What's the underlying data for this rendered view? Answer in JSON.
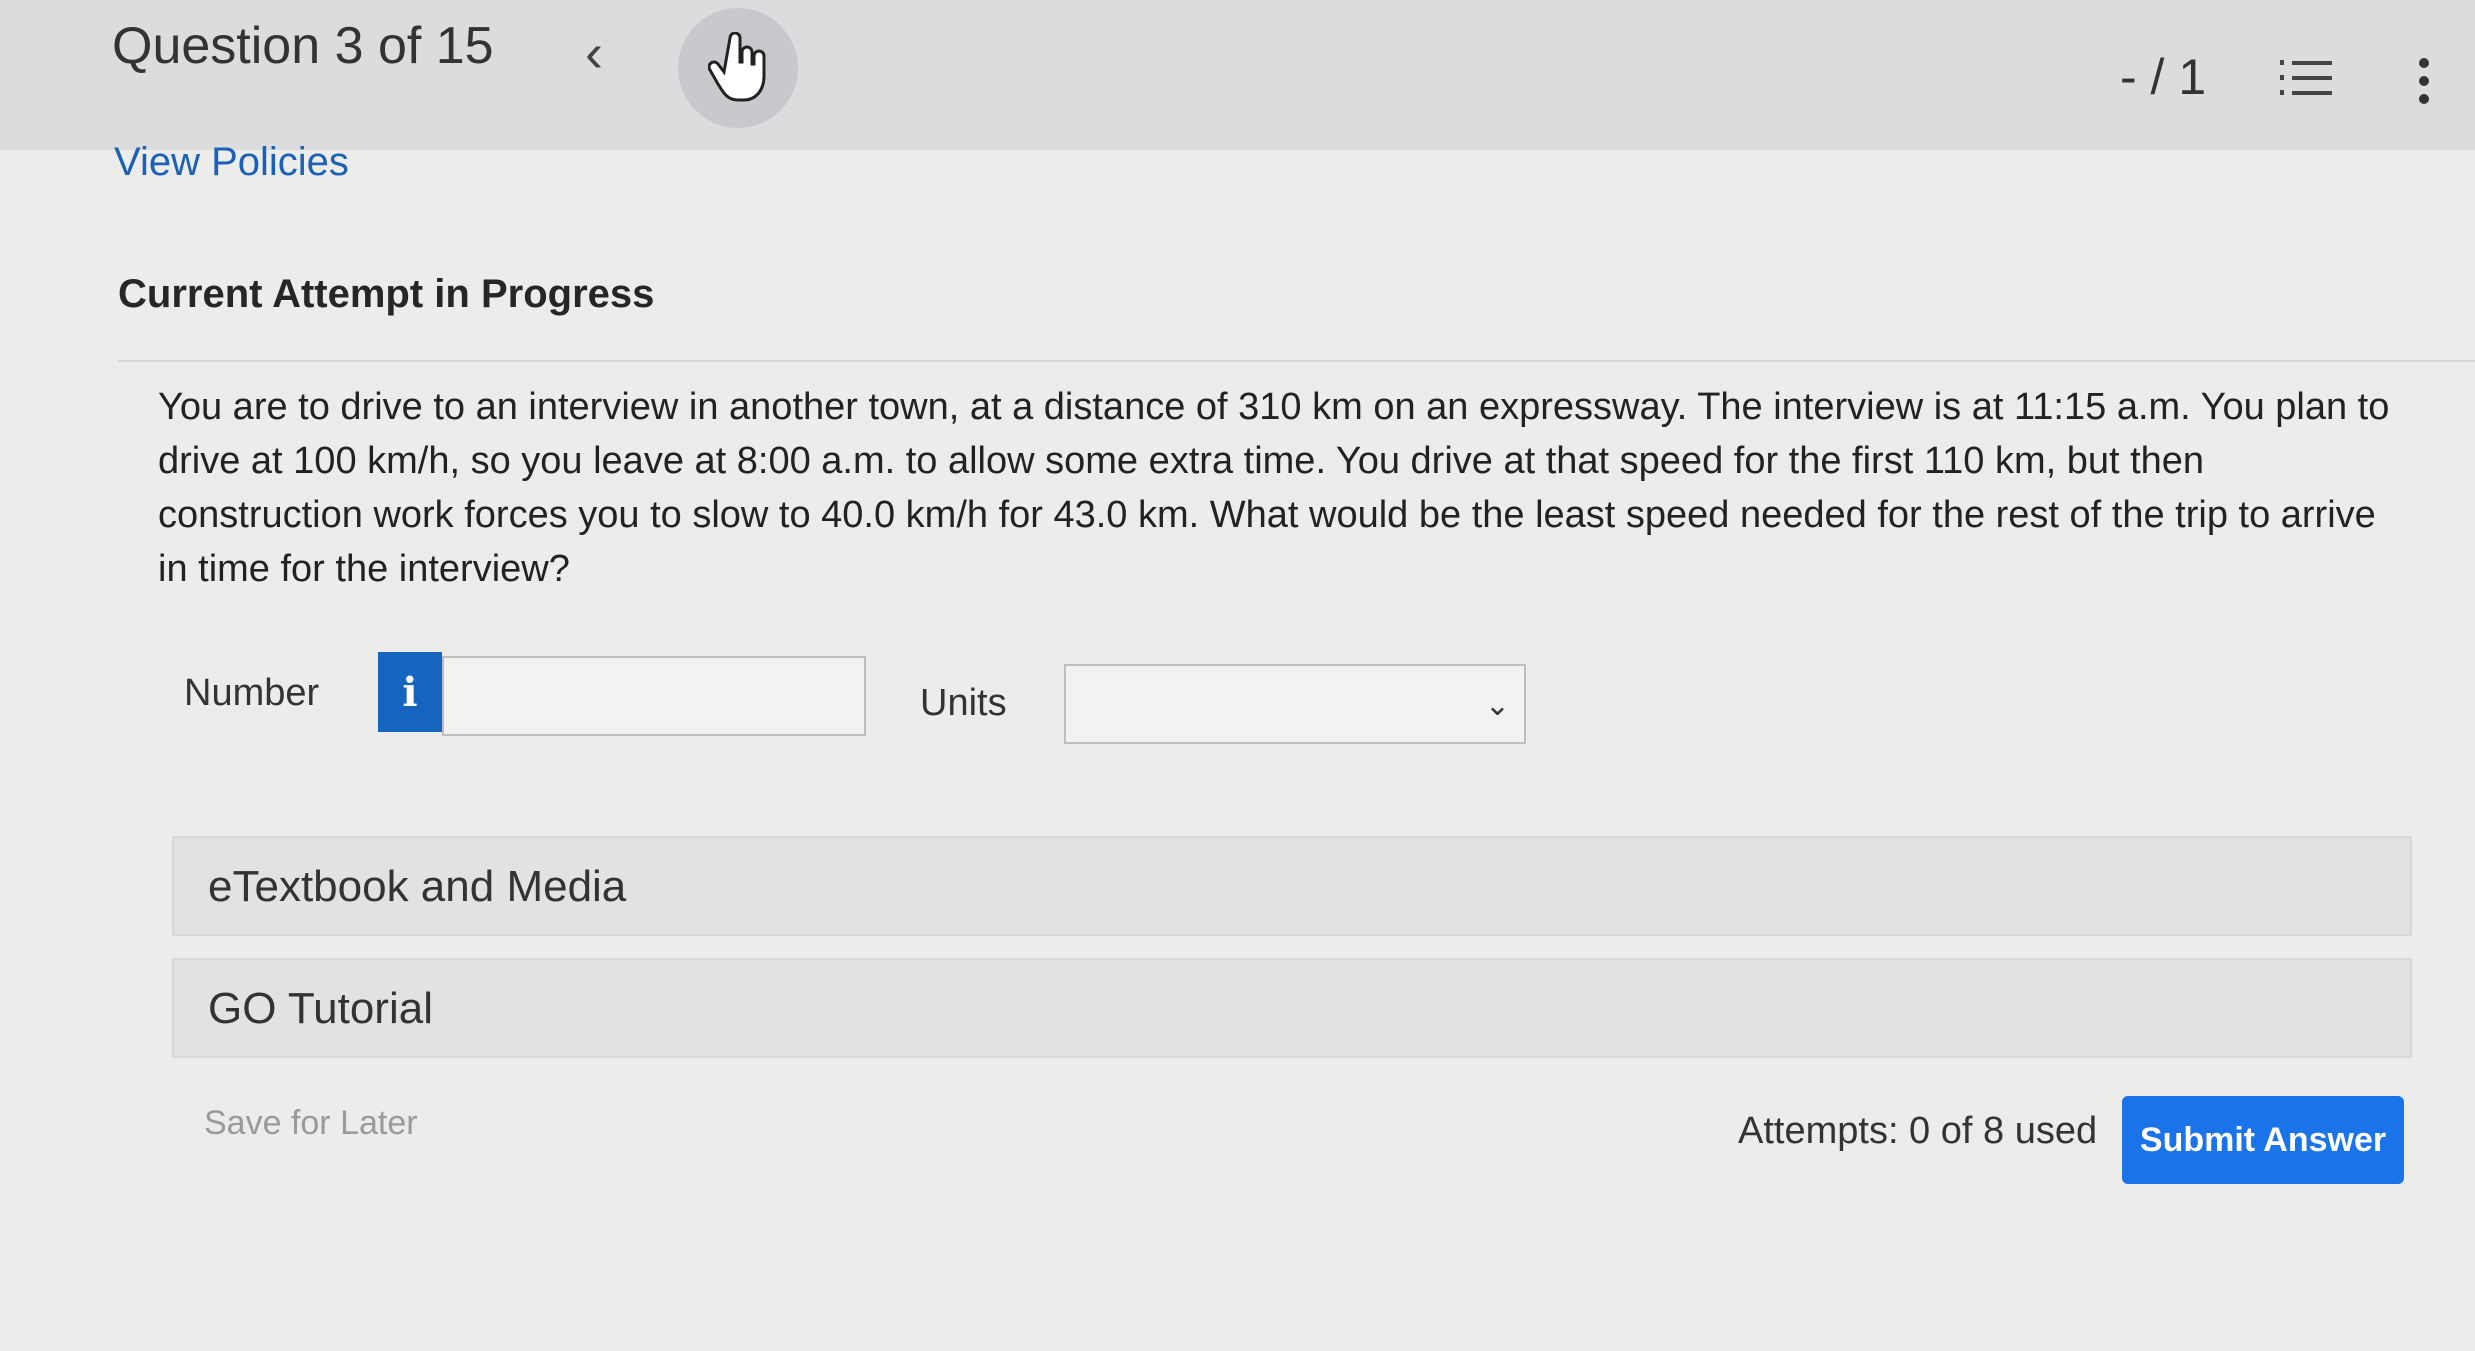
{
  "header": {
    "question_progress": "Question 3 of 15",
    "prev_icon": "chevron-left-icon",
    "pointer_icon": "hand-pointer-icon",
    "score": "- / 1",
    "list_icon": "numbered-list-icon",
    "more_icon": "vertical-dots-icon"
  },
  "links": {
    "view_policies": "View Policies"
  },
  "attempt": {
    "heading": "Current Attempt in Progress"
  },
  "question": {
    "text": "You are to drive to an interview in another town, at a distance of 310 km on an expressway. The interview is at 11:15 a.m. You plan to drive at 100 km/h, so you leave at 8:00 a.m. to allow some extra time. You drive at that speed for the first 110 km, but then construction work forces you to slow to 40.0 km/h for 43.0 km. What would be the least speed needed for the rest of the trip to arrive in time for the interview?"
  },
  "answer": {
    "number_label": "Number",
    "info_label": "i",
    "number_value": "",
    "units_label": "Units",
    "units_selected": ""
  },
  "resources": {
    "etextbook": "eTextbook and Media",
    "go_tutorial": "GO Tutorial"
  },
  "footer": {
    "save_later": "Save for Later",
    "attempts": "Attempts: 0 of 8 used",
    "submit": "Submit Answer"
  },
  "colors": {
    "accent": "#1a73e8",
    "link": "#1c61b5",
    "info_button": "#1565c0"
  }
}
